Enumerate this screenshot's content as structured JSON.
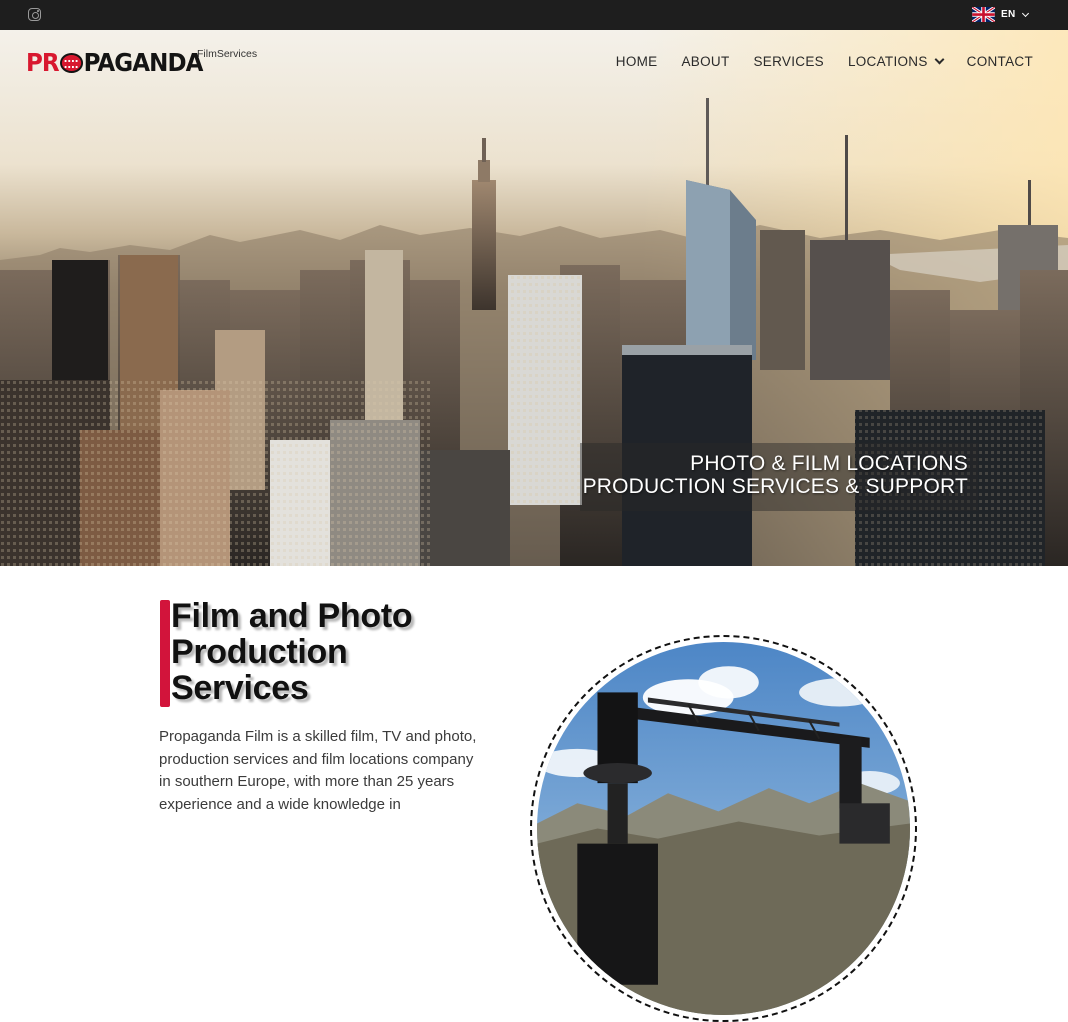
{
  "topbar": {
    "social_icon": "instagram-icon",
    "language": {
      "code": "EN",
      "flag": "uk-flag-icon"
    }
  },
  "brand": {
    "logo_prefix": "PR",
    "logo_suffix": "PAGANDA",
    "subtitle": "FilmServices",
    "accent_color": "#d8182f"
  },
  "nav": {
    "items": [
      {
        "label": "HOME"
      },
      {
        "label": "ABOUT"
      },
      {
        "label": "SERVICES"
      },
      {
        "label": "LOCATIONS",
        "has_dropdown": true
      },
      {
        "label": "CONTACT"
      }
    ]
  },
  "hero": {
    "tagline_line1": "PHOTO & FILM LOCATIONS",
    "tagline_line2": "PRODUCTION SERVICES & SUPPORT"
  },
  "intro": {
    "heading": "Film and Photo Production Services",
    "paragraph": "Propaganda Film is a skilled film, TV and photo, production services and film locations company in southern Europe, with more than 25 years experience and a wide knowledge in"
  }
}
